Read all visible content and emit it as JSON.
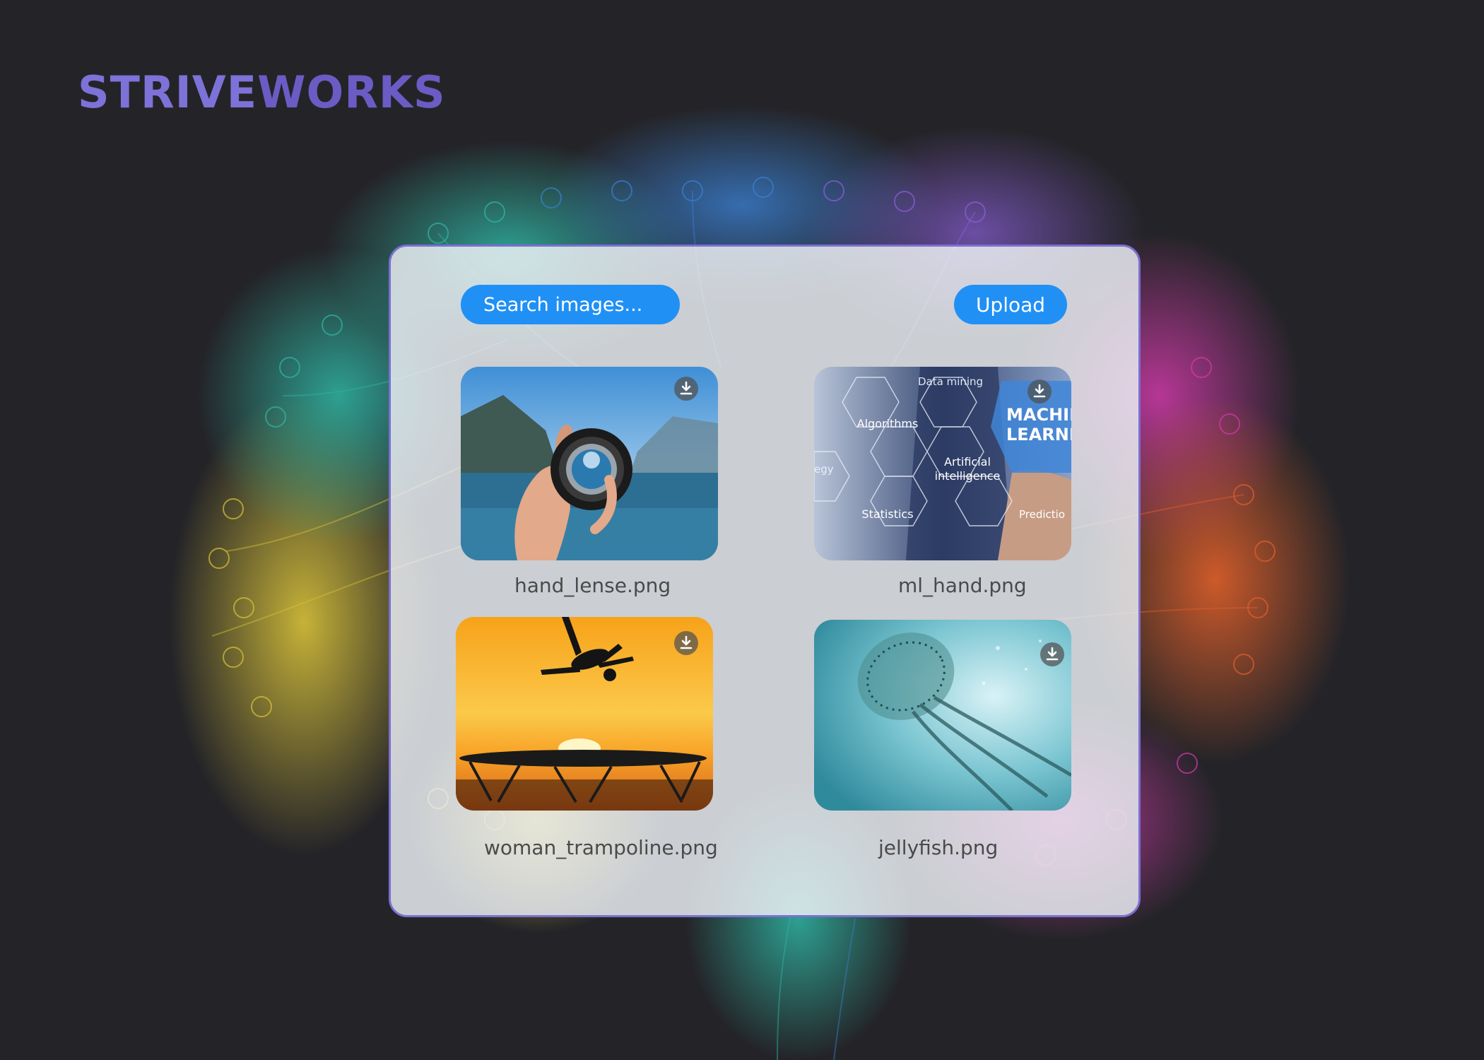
{
  "brand": {
    "name_part1": "STRIVE",
    "name_part2": "WORKS"
  },
  "toolbar": {
    "search_placeholder": "Search images...",
    "upload_label": "Upload"
  },
  "gallery": {
    "items": [
      {
        "filename": "hand_lense.png"
      },
      {
        "filename": "ml_hand.png"
      },
      {
        "filename": "woman_trampoline.png"
      },
      {
        "filename": "jellyfish.png"
      }
    ],
    "ml_thumb_labels": {
      "data_mining": "Data mining",
      "algorithms": "Algorithms",
      "ai_line1": "Artificial",
      "ai_line2": "intelligence",
      "statistics": "Statistics",
      "predictions": "Predictio",
      "strategy": "egy",
      "machine": "MACHIN",
      "learning": "LEARNIN"
    }
  },
  "colors": {
    "accent": "#2090f5",
    "brand": "#7d72d8",
    "background": "#242428",
    "panel_border": "#7a6fd0"
  },
  "icons": {
    "download": "download-icon"
  }
}
